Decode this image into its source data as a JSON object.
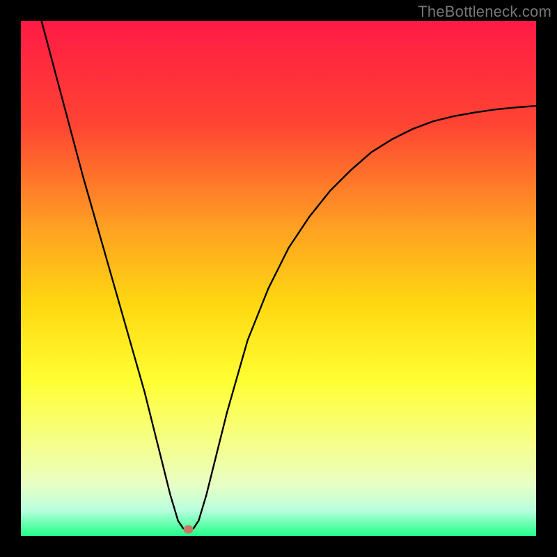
{
  "watermark": "TheBottleneck.com",
  "chart_data": {
    "type": "line",
    "title": "",
    "xlabel": "",
    "ylabel": "",
    "xlim": [
      0,
      100
    ],
    "ylim": [
      0,
      100
    ],
    "gradient_stops": [
      {
        "offset": 0.0,
        "color": "#ff1a45"
      },
      {
        "offset": 0.2,
        "color": "#ff4433"
      },
      {
        "offset": 0.4,
        "color": "#ffa022"
      },
      {
        "offset": 0.55,
        "color": "#ffd811"
      },
      {
        "offset": 0.7,
        "color": "#ffff33"
      },
      {
        "offset": 0.82,
        "color": "#f6ff8a"
      },
      {
        "offset": 0.9,
        "color": "#e8ffc4"
      },
      {
        "offset": 0.95,
        "color": "#b8ffdd"
      },
      {
        "offset": 1.0,
        "color": "#22ff88"
      }
    ],
    "series": [
      {
        "name": "bottleneck-curve",
        "x": [
          4,
          8,
          12,
          16,
          20,
          24,
          27,
          29,
          30.5,
          31.5,
          32.5,
          33.5,
          34.5,
          36,
          38,
          40,
          44,
          48,
          52,
          56,
          60,
          64,
          68,
          72,
          76,
          80,
          84,
          88,
          92,
          96,
          100
        ],
        "y": [
          100,
          85,
          70,
          56,
          42,
          28,
          16,
          8,
          3,
          1.5,
          1,
          1.5,
          3,
          8,
          16,
          24,
          38,
          48,
          56,
          62,
          67,
          71,
          74.5,
          77,
          79,
          80.5,
          81.5,
          82.2,
          82.8,
          83.2,
          83.5
        ]
      }
    ],
    "marker": {
      "x": 32.5,
      "y": 1.3,
      "color": "#cc7766",
      "radius": 7
    }
  }
}
